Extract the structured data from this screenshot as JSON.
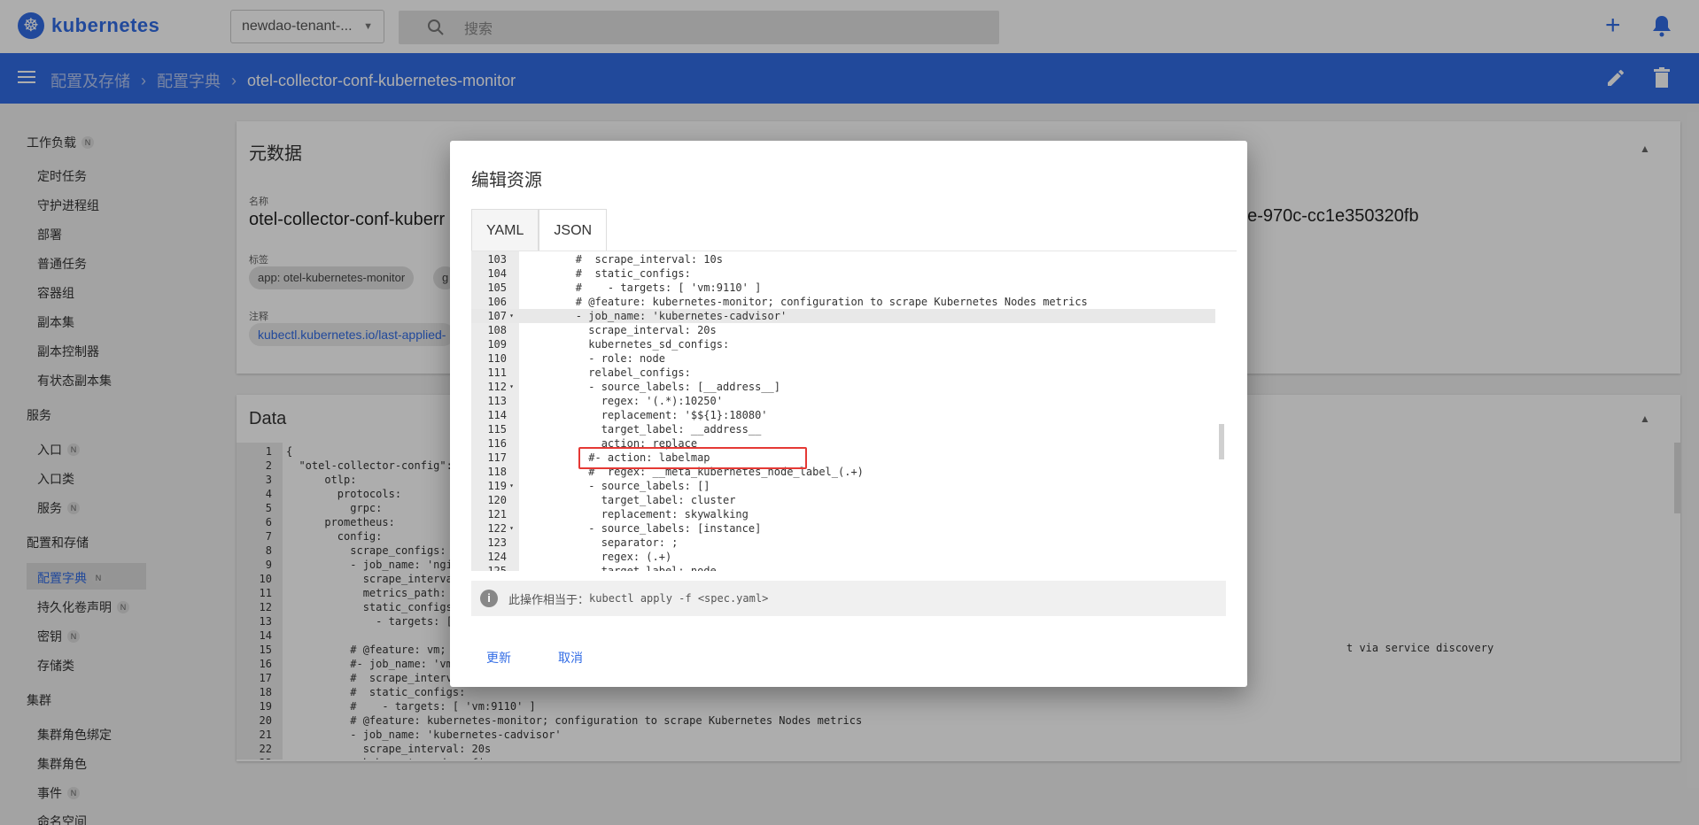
{
  "topbar": {
    "logo_text": "kubernetes",
    "namespace": "newdao-tenant-...",
    "search_placeholder": "搜索"
  },
  "breadcrumb": {
    "items": [
      "配置及存储",
      "配置字典"
    ],
    "current": "otel-collector-conf-kubernetes-monitor"
  },
  "sidebar": {
    "groups": [
      {
        "label": "工作负载",
        "badge": "N"
      },
      {
        "label": "服务",
        "badge": ""
      },
      {
        "label": "配置和存储",
        "badge": ""
      },
      {
        "label": "集群",
        "badge": ""
      }
    ],
    "items": [
      {
        "label": "定时任务",
        "badge": ""
      },
      {
        "label": "守护进程组",
        "badge": ""
      },
      {
        "label": "部署",
        "badge": ""
      },
      {
        "label": "普通任务",
        "badge": ""
      },
      {
        "label": "容器组",
        "badge": ""
      },
      {
        "label": "副本集",
        "badge": ""
      },
      {
        "label": "副本控制器",
        "badge": ""
      },
      {
        "label": "有状态副本集",
        "badge": ""
      },
      {
        "label": "入口",
        "badge": "N"
      },
      {
        "label": "入口类",
        "badge": ""
      },
      {
        "label": "服务",
        "badge": "N"
      },
      {
        "label": "配置字典",
        "badge": "N"
      },
      {
        "label": "持久化卷声明",
        "badge": "N"
      },
      {
        "label": "密钥",
        "badge": "N"
      },
      {
        "label": "存储类",
        "badge": ""
      },
      {
        "label": "集群角色绑定",
        "badge": ""
      },
      {
        "label": "集群角色",
        "badge": ""
      },
      {
        "label": "事件",
        "badge": "N"
      },
      {
        "label": "命名空间",
        "badge": ""
      }
    ]
  },
  "metadata": {
    "title": "元数据",
    "name_label": "名称",
    "name_value": "otel-collector-conf-kuberr",
    "uid_value": "4e-970c-cc1e350320fb",
    "labels_label": "标签",
    "label_chip_1": "app: otel-kubernetes-monitor",
    "label_chip_2": "g",
    "annotations_label": "注释",
    "annotation_chip": "kubectl.kubernetes.io/last-applied-"
  },
  "data_card": {
    "title": "Data",
    "lines": [
      {
        "n": "1",
        "text": "{"
      },
      {
        "n": "2",
        "text": "  \"otel-collector-config\":"
      },
      {
        "n": "3",
        "text": "      otlp:"
      },
      {
        "n": "4",
        "text": "        protocols:"
      },
      {
        "n": "5",
        "text": "          grpc:"
      },
      {
        "n": "6",
        "text": "      prometheus:"
      },
      {
        "n": "7",
        "text": "        config:"
      },
      {
        "n": "8",
        "text": "          scrape_configs:"
      },
      {
        "n": "9",
        "text": "          - job_name: 'ngi"
      },
      {
        "n": "10",
        "text": "            scrape_interva"
      },
      {
        "n": "11",
        "text": "            metrics_path: '"
      },
      {
        "n": "12",
        "text": "            static_configs"
      },
      {
        "n": "13",
        "text": "              - targets: ['"
      },
      {
        "n": "14",
        "text": ""
      },
      {
        "n": "15",
        "text": "          # @feature: vm; :"
      },
      {
        "n": "16",
        "text": "          #- job_name: 'vm"
      },
      {
        "n": "17",
        "text": "          #  scrape_interv"
      },
      {
        "n": "18",
        "text": "          #  static_configs:"
      },
      {
        "n": "19",
        "text": "          #    - targets: [ 'vm:9110' ]"
      },
      {
        "n": "20",
        "text": "          # @feature: kubernetes-monitor; configuration to scrape Kubernetes Nodes metrics"
      },
      {
        "n": "21",
        "text": "          - job_name: 'kubernetes-cadvisor'"
      },
      {
        "n": "22",
        "text": "            scrape_interval: 20s"
      },
      {
        "n": "23",
        "text": "            kubernetes_sd_configs:"
      }
    ],
    "right_fragment": "t via service discovery"
  },
  "dialog": {
    "title": "编辑资源",
    "tab_yaml": "YAML",
    "tab_json": "JSON",
    "lines": [
      {
        "n": "103",
        "fold": false,
        "text": "        #  scrape_interval: 10s"
      },
      {
        "n": "104",
        "fold": false,
        "text": "        #  static_configs:"
      },
      {
        "n": "105",
        "fold": false,
        "text": "        #    - targets: [ 'vm:9110' ]"
      },
      {
        "n": "106",
        "fold": false,
        "text": "        # @feature: kubernetes-monitor; configuration to scrape Kubernetes Nodes metrics"
      },
      {
        "n": "107",
        "fold": true,
        "text": "        - job_name: 'kubernetes-cadvisor'"
      },
      {
        "n": "108",
        "fold": false,
        "text": "          scrape_interval: 20s"
      },
      {
        "n": "109",
        "fold": false,
        "text": "          kubernetes_sd_configs:"
      },
      {
        "n": "110",
        "fold": false,
        "text": "          - role: node"
      },
      {
        "n": "111",
        "fold": false,
        "text": "          relabel_configs:"
      },
      {
        "n": "112",
        "fold": true,
        "text": "          - source_labels: [__address__]"
      },
      {
        "n": "113",
        "fold": false,
        "text": "            regex: '(.*):10250'"
      },
      {
        "n": "114",
        "fold": false,
        "text": "            replacement: '$${1}:18080'"
      },
      {
        "n": "115",
        "fold": false,
        "text": "            target_label: __address__"
      },
      {
        "n": "116",
        "fold": false,
        "text": "            action: replace"
      },
      {
        "n": "117",
        "fold": false,
        "text": "          #- action: labelmap"
      },
      {
        "n": "118",
        "fold": false,
        "text": "          #  regex: __meta_kubernetes_node_label_(.+)"
      },
      {
        "n": "119",
        "fold": true,
        "text": "          - source_labels: []"
      },
      {
        "n": "120",
        "fold": false,
        "text": "            target_label: cluster"
      },
      {
        "n": "121",
        "fold": false,
        "text": "            replacement: skywalking"
      },
      {
        "n": "122",
        "fold": true,
        "text": "          - source_labels: [instance]"
      },
      {
        "n": "123",
        "fold": false,
        "text": "            separator: ;"
      },
      {
        "n": "124",
        "fold": false,
        "text": "            regex: (.+)"
      },
      {
        "n": "125",
        "fold": false,
        "text": "            target_label: node"
      }
    ],
    "info_text": "此操作相当于：",
    "info_cmd": "kubectl apply -f <spec.yaml>",
    "update_label": "更新",
    "cancel_label": "取消"
  },
  "colors": {
    "brand": "#326ce5",
    "highlight_box": "#e53935"
  }
}
